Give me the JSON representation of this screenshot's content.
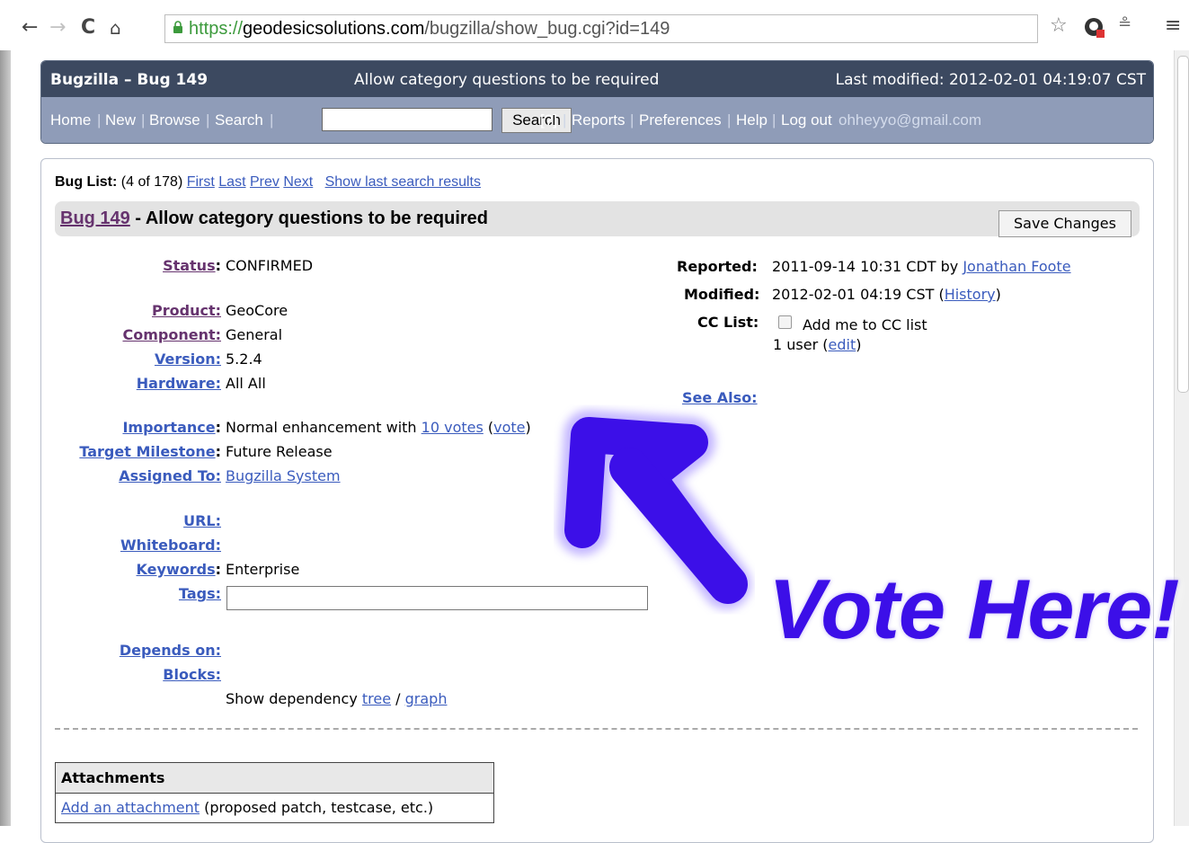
{
  "browser": {
    "url_scheme": "https://",
    "url_host": "geodesicsolutions.com",
    "url_path": "/bugzilla/show_bug.cgi?id=149",
    "back_icon": "back-arrow-icon",
    "forward_icon": "forward-arrow-icon",
    "reload_icon": "reload-icon",
    "home_icon": "home-icon"
  },
  "header": {
    "bug_title": "Bugzilla – Bug 149",
    "summary": "Allow category questions to be required",
    "last_modified": "Last modified: 2012-02-01 04:19:07 CST"
  },
  "nav": {
    "home": "Home",
    "new": "New",
    "browse": "Browse",
    "search": "Search",
    "search_button": "Search",
    "help_q": "[?]",
    "reports": "Reports",
    "preferences": "Preferences",
    "help": "Help",
    "logout": "Log out",
    "user": "ohheyyo@gmail.com",
    "sep": "|"
  },
  "buglist": {
    "label": "Bug List:",
    "count": "(4 of 178)",
    "first": "First",
    "last": "Last",
    "prev": "Prev",
    "next": "Next",
    "show_last": "Show last search results"
  },
  "bug": {
    "id_link": "Bug 149",
    "title_rest": " - Allow category questions to be required",
    "save_button": "Save Changes"
  },
  "fields": {
    "status_label": "Status",
    "status_value": "CONFIRMED",
    "product_label": "Product:",
    "product_value": "GeoCore",
    "component_label": "Component:",
    "component_value": "General",
    "version_label": "Version:",
    "version_value": "5.2.4",
    "hardware_label": "Hardware:",
    "hardware_value": "All All",
    "importance_label": "Importance",
    "importance_value": "Normal enhancement with ",
    "votes_link": "10 votes",
    "vote_link": "vote",
    "milestone_label": "Target Milestone",
    "milestone_value": "Future Release",
    "assigned_label": "Assigned To:",
    "assigned_value": "Bugzilla System",
    "url_label": "URL:",
    "whiteboard_label": "Whiteboard:",
    "keywords_label": "Keywords",
    "keywords_value": "Enterprise",
    "tags_label": "Tags:",
    "depends_label": "Depends on:",
    "blocks_label": "Blocks:",
    "show_dep": "Show dependency ",
    "tree": "tree",
    "graph": "graph"
  },
  "right": {
    "reported_label": "Reported:",
    "reported_value": "2011-09-14 10:31 CDT by ",
    "reporter": "Jonathan Foote",
    "modified_label": "Modified:",
    "modified_value": "2012-02-01 04:19 CST (",
    "history": "History",
    "cc_label": "CC List:",
    "cc_add": "Add me to CC list",
    "cc_users": "1 user (",
    "edit": "edit",
    "see_also": "See Also:"
  },
  "attachments": {
    "header": "Attachments",
    "add_link": "Add an attachment",
    "add_rest": " (proposed patch, testcase, etc.)"
  },
  "annotation": {
    "text": "Vote Here!",
    "color": "#3c0fe8"
  }
}
